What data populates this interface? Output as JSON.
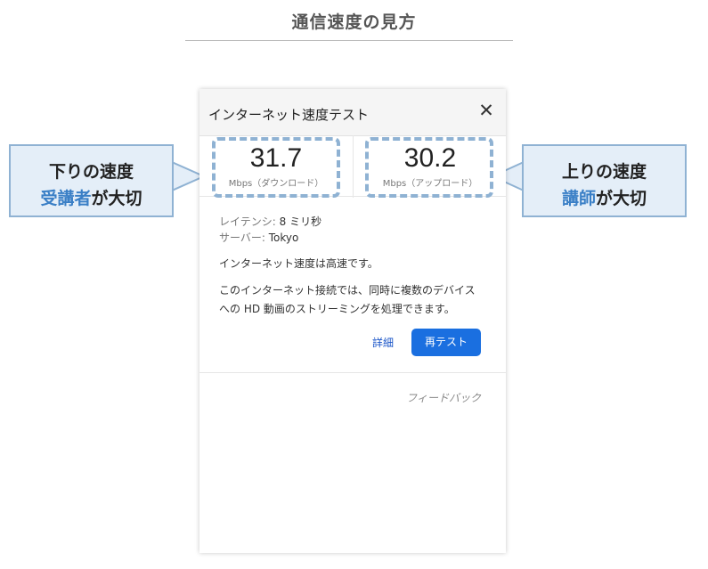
{
  "page_title": "通信速度の見方",
  "panel": {
    "title": "インターネット速度テスト",
    "close_glyph": "✕",
    "download": {
      "value": "31.7",
      "unit": "Mbps（ダウンロード）"
    },
    "upload": {
      "value": "30.2",
      "unit": "Mbps（アップロード）"
    },
    "latency_label": "レイテンシ:",
    "latency_value": "8 ミリ秒",
    "server_label": "サーバー:",
    "server_value": "Tokyo",
    "summary": "インターネット速度は高速です。",
    "description_line1": "このインターネット接続では、同時に複数のデバイス",
    "description_line2": "への HD 動画のストリーミングを処理できます。",
    "details_link": "詳細",
    "retest_button": "再テスト",
    "feedback_link": "フィードバック"
  },
  "callouts": {
    "left": {
      "line1": "下りの速度",
      "line2_highlight": "受講者",
      "line2_rest": "が大切"
    },
    "right": {
      "line1": "上りの速度",
      "line2_highlight": "講師",
      "line2_rest": "が大切"
    }
  },
  "colors": {
    "accent_blue": "#3a7fc6",
    "dash_frame": "#8fb2d3",
    "button_blue": "#1a6fe0",
    "callout_fill": "#e4eef8"
  }
}
